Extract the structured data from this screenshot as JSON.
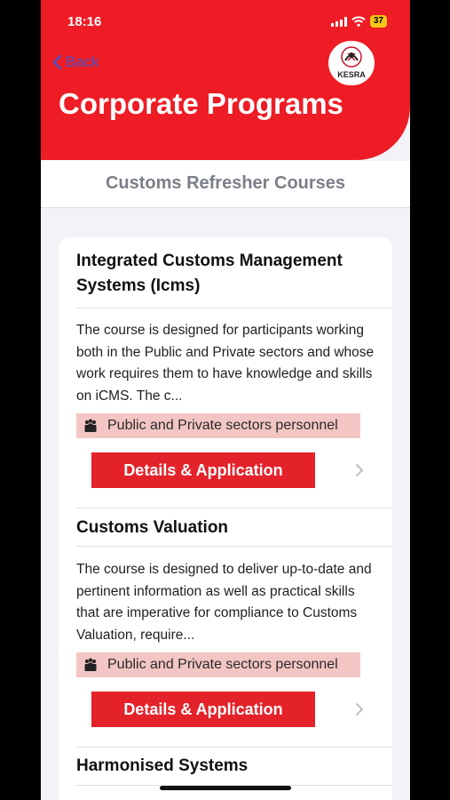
{
  "status_bar": {
    "time": "18:16",
    "battery": "37"
  },
  "nav": {
    "back_label": "Back",
    "title": "Corporate Programs",
    "logo_text": "KESRA"
  },
  "section": {
    "title": "Customs Refresher Courses"
  },
  "courses": [
    {
      "title": "Integrated Customs Management Systems (Icms)",
      "description": "The course is designed for participants working both in the Public and Private sectors and whose work requires them to have knowledge and skills on iCMS. The c...",
      "audience": "Public and Private sectors personnel",
      "button_label": "Details & Application"
    },
    {
      "title": "Customs Valuation",
      "description": "The course is designed to deliver up-to-date and pertinent information as well as practical skills that are imperative for compliance to Customs Valuation, require...",
      "audience": "Public and Private sectors personnel",
      "button_label": "Details & Application"
    },
    {
      "title": "Harmonised Systems"
    }
  ],
  "colors": {
    "brand_red": "#ee1c25",
    "button_red": "#e4222a",
    "audience_bg": "#f3c6c3",
    "back_link": "#3b5bdb"
  },
  "icons": [
    "chevron-left-icon",
    "people-icon",
    "chevron-right-icon",
    "signal-icon",
    "wifi-icon",
    "battery-icon"
  ]
}
